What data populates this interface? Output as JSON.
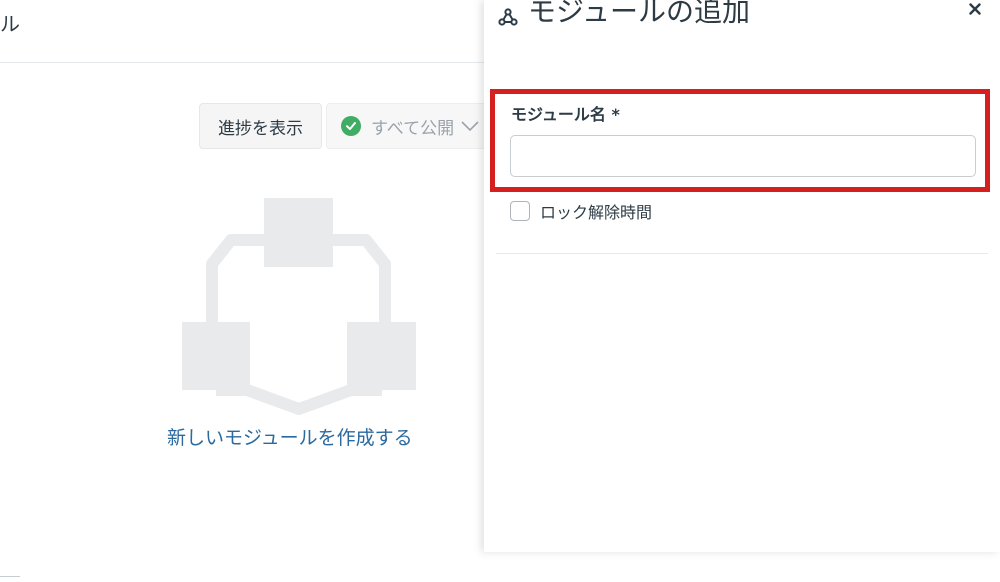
{
  "background": {
    "page_title_fragment": "ル",
    "progress_button": "進捗を表示",
    "publish_button": "すべて公開",
    "empty_state_link": "新しいモジュールを作成する"
  },
  "tray": {
    "title": "モジュールの追加",
    "close_symbol": "×",
    "module_name_label": "モジュール名 *",
    "module_name_value": "",
    "module_name_placeholder": "",
    "lock_until_label": "ロック解除時間"
  },
  "icons": {
    "module": "modules-icon",
    "close": "close-icon",
    "publish_status": "check-circle-icon",
    "dropdown": "chevron-down-icon"
  },
  "colors": {
    "highlight": "#d6201f",
    "link": "#2b6a9f",
    "published": "#3fae64",
    "illustration": "#e8eaec"
  }
}
